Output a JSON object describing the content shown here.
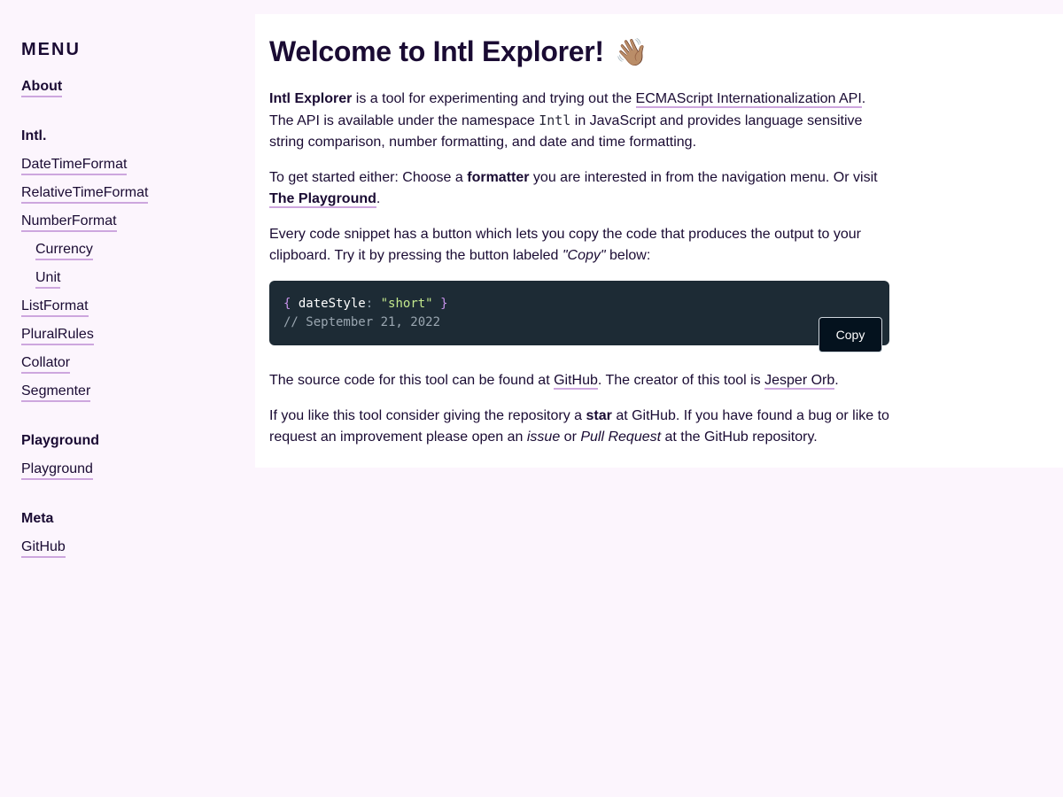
{
  "sidebar": {
    "menu_title": "MENU",
    "about": "About",
    "sections": [
      {
        "heading": "Intl.",
        "items": [
          {
            "label": "DateTimeFormat"
          },
          {
            "label": "RelativeTimeFormat"
          },
          {
            "label": "NumberFormat"
          },
          {
            "label": "Currency"
          },
          {
            "label": "Unit"
          },
          {
            "label": "ListFormat"
          },
          {
            "label": "PluralRules"
          },
          {
            "label": "Collator"
          },
          {
            "label": "Segmenter"
          }
        ]
      },
      {
        "heading": "Playground",
        "items": [
          {
            "label": "Playground"
          }
        ]
      },
      {
        "heading": "Meta",
        "items": [
          {
            "label": "GitHub"
          }
        ]
      }
    ]
  },
  "main": {
    "title": "Welcome to Intl Explorer!",
    "title_emoji": "👋🏽",
    "intro": {
      "strong": "Intl Explorer",
      "t1": " is a tool for experimenting and trying out the ",
      "link": "ECMAScript Internationalization API",
      "t2": ". The API is available under the namespace ",
      "code": "Intl",
      "t3": " in JavaScript and provides language sensitive string comparison, number formatting, and date and time formatting."
    },
    "started": {
      "t1": "To get started either: Choose a ",
      "strong": "formatter",
      "t2": " you are interested in from the navigation menu. Or visit ",
      "link": "The Playground",
      "t3": "."
    },
    "snippet": {
      "t1": "Every code snippet has a button which lets you copy the code that produces the output to your clipboard. Try it by pressing the button labeled ",
      "em": "\"Copy\"",
      "t2": " below:"
    },
    "code": {
      "open_brace": "{",
      "key": "dateStyle",
      "colon": ":",
      "value": "\"short\"",
      "close_brace": "}",
      "comment": "// September 21, 2022",
      "copy_label": "Copy"
    },
    "source": {
      "t1": "The source code for this tool can be found at ",
      "link1": "GitHub",
      "t2": ". The creator of this tool is ",
      "link2": "Jesper Orb",
      "t3": "."
    },
    "star": {
      "t1": "If you like this tool consider giving the repository a ",
      "strong": "star",
      "t2": " at GitHub. If you have found a bug or like to request an improvement please open an ",
      "em1": "issue",
      "t3": " or ",
      "em2": "Pull Request",
      "t4": " at the GitHub repository."
    }
  },
  "colors": {
    "background": "#fcf5fd",
    "card": "#ffffff",
    "text": "#1a0b33",
    "link_underline": "#cda6de",
    "code_bg": "#1d2b35",
    "copy_button_bg": "#04121e"
  }
}
